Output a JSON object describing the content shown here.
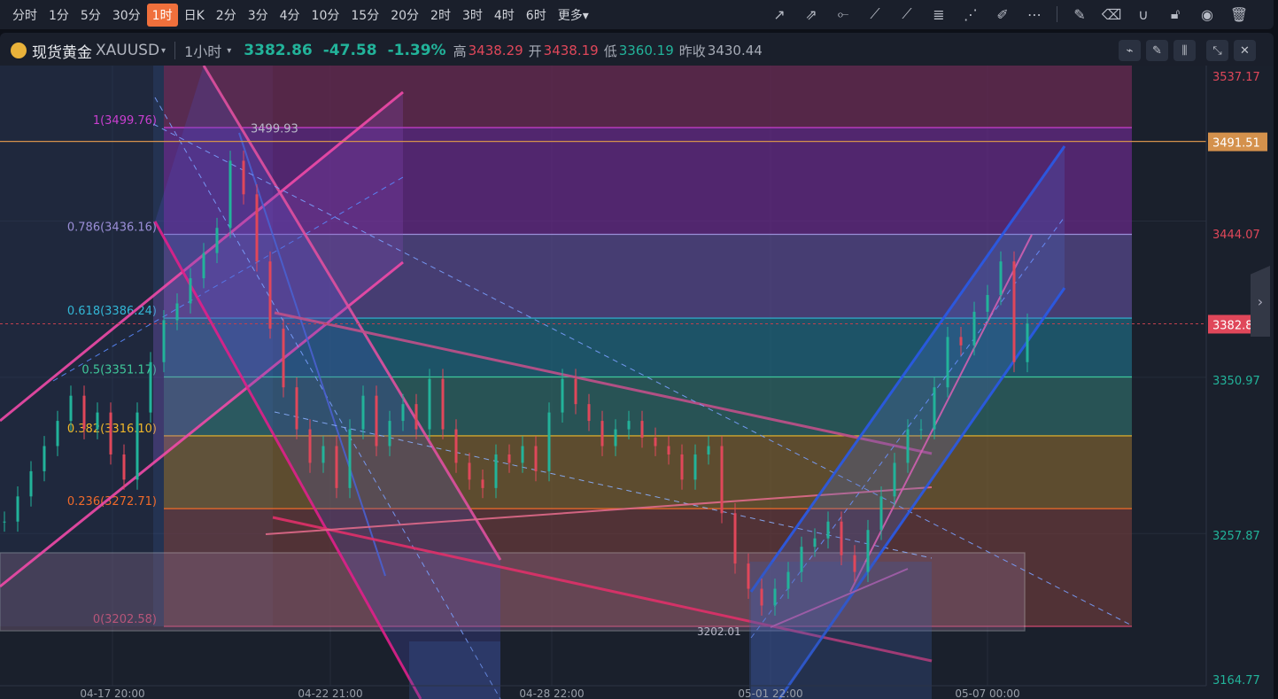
{
  "toolbar": {
    "timeframes": [
      "分时",
      "1分",
      "5分",
      "30分",
      "1时",
      "日K",
      "2分",
      "3分",
      "4分",
      "10分",
      "15分",
      "20分",
      "2时",
      "3时",
      "4时",
      "6时",
      "更多▾"
    ],
    "active": "1时",
    "drawing_tools": [
      "trend-line-icon",
      "ray-icon",
      "horizontal-line-icon",
      "segment-icon",
      "extended-line-icon",
      "fibonacci-icon",
      "gann-fan-icon",
      "brush-icon",
      "more-icon",
      "edit-icon",
      "eraser-icon",
      "magnet-icon",
      "unlock-icon",
      "eye-icon",
      "trash-icon"
    ]
  },
  "header": {
    "name": "现货黄金",
    "symbol": "XAUUSD",
    "interval": "1小时",
    "price": "3382.86",
    "change": "-47.58",
    "change_pct": "-1.39%",
    "high_label": "高",
    "high": "3438.29",
    "open_label": "开",
    "open": "3438.19",
    "low_label": "低",
    "low": "3360.19",
    "prev_label": "昨收",
    "prev": "3430.44"
  },
  "colors": {
    "up": "#22b39a",
    "down": "#e0475a",
    "accent": "#f0703c",
    "last_price": "#e0475a",
    "alert_line": "#d4914c"
  },
  "chart_data": {
    "type": "candlestick",
    "symbol": "XAUUSD",
    "interval": "1h",
    "x_labels": [
      "04-17 20:00",
      "04-22 21:00",
      "04-28 22:00",
      "05-01 22:00",
      "05-07 00:00"
    ],
    "y_labels": [
      "3537.17",
      "3444.07",
      "3350.97",
      "3257.87",
      "3164.77"
    ],
    "alert_price": "3491.51",
    "last_price": "3382.86",
    "high_marker": "3499.93",
    "low_marker": "3202.01",
    "fib_levels": [
      {
        "label": "1(3499.76)",
        "price": 3499.76,
        "color": "#c93fd0"
      },
      {
        "label": "0.786(3436.16)",
        "price": 3436.16,
        "color": "#9b8fd8"
      },
      {
        "label": "0.618(3386.24)",
        "price": 3386.24,
        "color": "#33b7d6"
      },
      {
        "label": "0.5(3351.17)",
        "price": 3351.17,
        "color": "#3fc79a"
      },
      {
        "label": "0.382(3316.10)",
        "price": 3316.1,
        "color": "#f0b82a"
      },
      {
        "label": "0.236(3272.71)",
        "price": 3272.71,
        "color": "#f06a2a"
      },
      {
        "label": "0(3202.58)",
        "price": 3202.58,
        "color": "#d04a70"
      }
    ],
    "closes": [
      3265,
      3280,
      3295,
      3310,
      3325,
      3340,
      3320,
      3330,
      3305,
      3290,
      3330,
      3360,
      3385,
      3395,
      3410,
      3425,
      3440,
      3480,
      3460,
      3420,
      3380,
      3345,
      3320,
      3300,
      3310,
      3285,
      3320,
      3340,
      3310,
      3325,
      3335,
      3320,
      3350,
      3320,
      3300,
      3290,
      3285,
      3305,
      3300,
      3310,
      3295,
      3330,
      3350,
      3335,
      3325,
      3310,
      3320,
      3325,
      3315,
      3310,
      3305,
      3290,
      3305,
      3310,
      3270,
      3240,
      3225,
      3215,
      3225,
      3235,
      3250,
      3255,
      3265,
      3245,
      3235,
      3260,
      3280,
      3300,
      3320,
      3320,
      3345,
      3375,
      3370,
      3390,
      3400,
      3420,
      3360,
      3383
    ]
  }
}
